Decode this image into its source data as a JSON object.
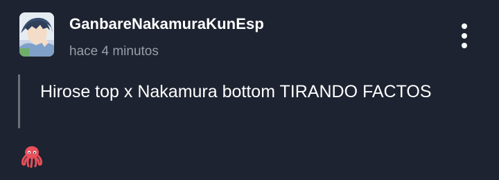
{
  "comment": {
    "username": "GanbareNakamuraKunEsp",
    "timestamp": "hace 4 minutos",
    "text": "Hirose top x Nakamura bottom TIRANDO FACTOS"
  },
  "icons": {
    "avatar": "anime-character-avatar",
    "menu": "more-options-vertical-dots-icon",
    "reaction": "octopus-emoji-icon"
  },
  "colors": {
    "background": "#1d2330",
    "username": "#ffffff",
    "timestamp": "#9aa0a8",
    "quote_bar": "#6b7079",
    "reaction": "#e8505b"
  }
}
